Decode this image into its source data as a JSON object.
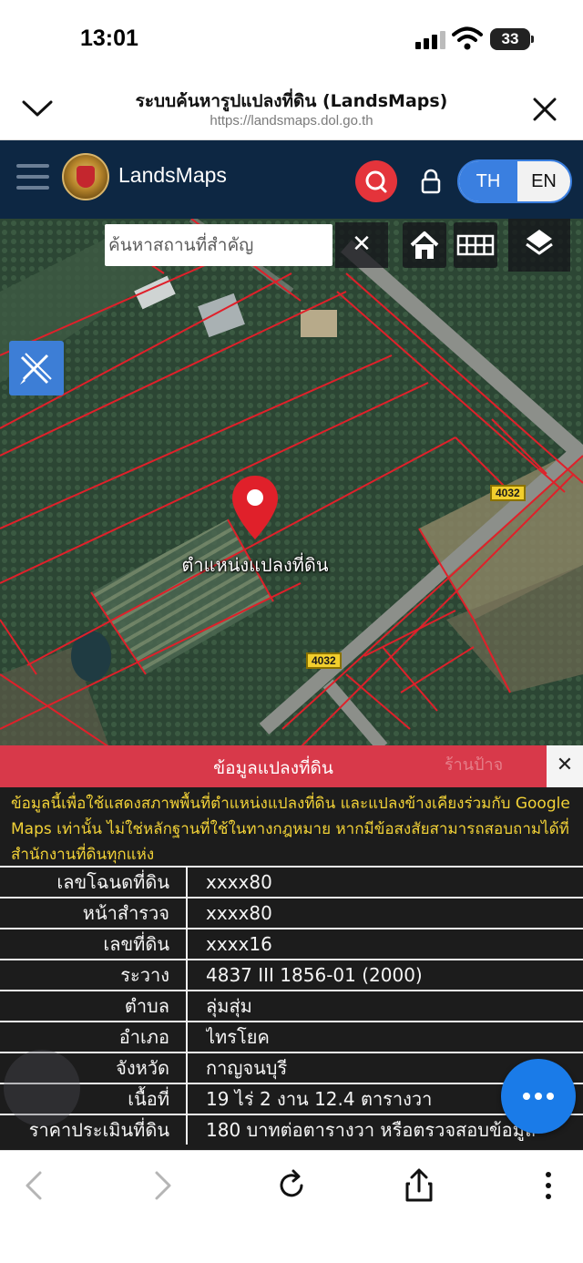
{
  "status_bar": {
    "time": "13:01",
    "battery": "33"
  },
  "browser": {
    "title": "ระบบค้นหารูปแปลงที่ดิน (LandsMaps)",
    "url": "https://landsmaps.dol.go.th"
  },
  "app": {
    "brand": "LandsMaps",
    "lang_th": "TH",
    "lang_en": "EN"
  },
  "map": {
    "search_placeholder": "ค้นหาสถานที่สำคัญ",
    "clear_label": "✕",
    "pin_label": "ตำแหน่งแปลงที่ดิน",
    "road_signs": [
      "4032",
      "4032"
    ]
  },
  "panel": {
    "title": "ข้อมูลแปลงที่ดิน",
    "close_label": "✕",
    "watermark": "ร้านป้าจ",
    "notice": "ข้อมูลนี้เพื่อใช้แสดงสภาพพื้นที่ตำแหน่งแปลงที่ดิน และแปลงข้างเคียงร่วมกับ Google Maps เท่านั้น ไม่ใช่หลักฐานที่ใช้ในทางกฎหมาย หากมีข้อสงสัยสามารถสอบถามได้ที่สำนักงานที่ดินทุกแห่ง",
    "rows": [
      {
        "key": "เลขโฉนดที่ดิน",
        "value": "xxxx80"
      },
      {
        "key": "หน้าสำรวจ",
        "value": "xxxx80"
      },
      {
        "key": "เลขที่ดิน",
        "value": "xxxx16"
      },
      {
        "key": "ระวาง",
        "value": "4837 III 1856-01 (2000)"
      },
      {
        "key": "ตำบล",
        "value": "ลุ่มสุ่ม"
      },
      {
        "key": "อำเภอ",
        "value": "ไทรโยค"
      },
      {
        "key": "จังหวัด",
        "value": "กาญจนบุรี"
      },
      {
        "key": "เนื้อที่",
        "value": "19 ไร่ 2 งาน 12.4 ตารางวา"
      },
      {
        "key": "ราคาประเมินที่ดิน",
        "value": "180 บาทต่อตารางวา หรือตรวจสอบข้อมูล"
      }
    ]
  },
  "colors": {
    "app_header": "#0d2743",
    "accent_red": "#e4343b",
    "panel_header": "#d8394a",
    "notice_text": "#f2d237",
    "toggle_blue": "#3a7fe0",
    "fab_blue": "#1a7be8",
    "parcel_lines": "#e0202a"
  },
  "icons": {
    "menu": "hamburger-icon",
    "search": "search-icon",
    "lock": "lock-icon",
    "home": "home-icon",
    "grid": "grid-icon",
    "layers": "layers-icon",
    "draw": "ruler-pencil-icon",
    "pin": "map-pin-icon",
    "more": "ellipsis-icon"
  }
}
